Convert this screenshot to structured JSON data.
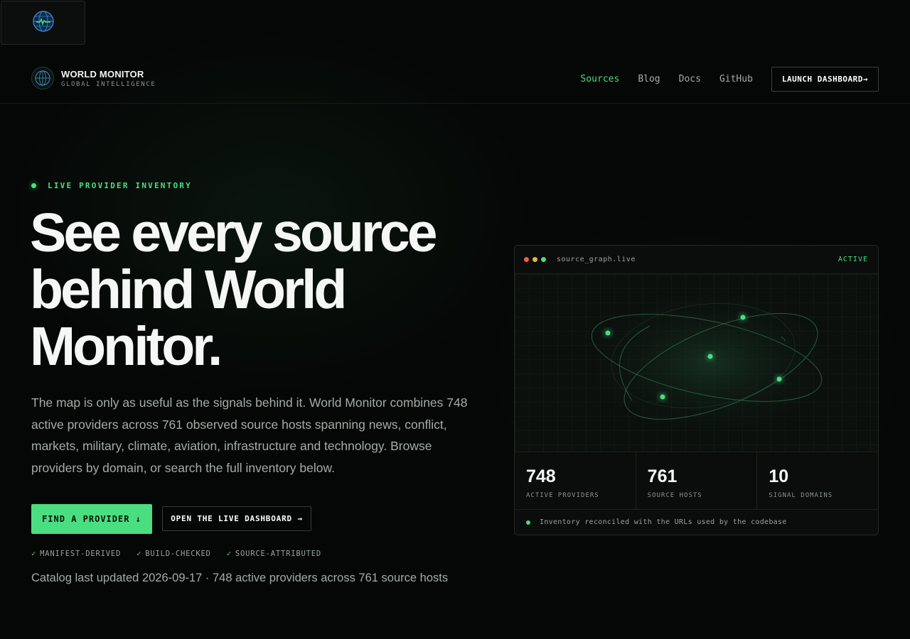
{
  "brand": {
    "name": "WORLD MONITOR",
    "tagline": "GLOBAL INTELLIGENCE",
    "logo_icon": "globe-icon"
  },
  "nav": {
    "items": [
      {
        "label": "Sources",
        "active": true
      },
      {
        "label": "Blog",
        "active": false
      },
      {
        "label": "Docs",
        "active": false
      },
      {
        "label": "GitHub",
        "active": false
      }
    ],
    "launch_label": "LAUNCH DASHBOARD→"
  },
  "hero": {
    "eyebrow": "LIVE PROVIDER INVENTORY",
    "headline": "See every source behind World Monitor.",
    "lede": "The map is only as useful as the signals behind it. World Monitor combines 748 active providers across 761 observed source hosts spanning news, conflict, markets, military, climate, aviation, infrastructure and technology. Browse providers by domain, or search the full inventory below.",
    "cta_primary": "FIND A PROVIDER ↓",
    "cta_secondary": "OPEN THE LIVE DASHBOARD →",
    "checks": [
      "MANIFEST-DERIVED",
      "BUILD-CHECKED",
      "SOURCE-ATTRIBUTED"
    ],
    "check_glyph": "✓",
    "updated": "Catalog last updated 2026-09-17 · 748 active providers across 761 source hosts"
  },
  "card": {
    "title": "source_graph.live",
    "status": "ACTIVE",
    "stats": [
      {
        "value": "748",
        "label": "ACTIVE PROVIDERS"
      },
      {
        "value": "761",
        "label": "SOURCE HOSTS"
      },
      {
        "value": "10",
        "label": "SIGNAL DOMAINS"
      }
    ],
    "footer": "Inventory reconciled with the URLs used by the codebase"
  },
  "colors": {
    "accent": "#4ade80",
    "background": "#050706",
    "dot_red": "#ef5f4f",
    "dot_yellow": "#f0b429",
    "dot_green": "#4ade80"
  }
}
